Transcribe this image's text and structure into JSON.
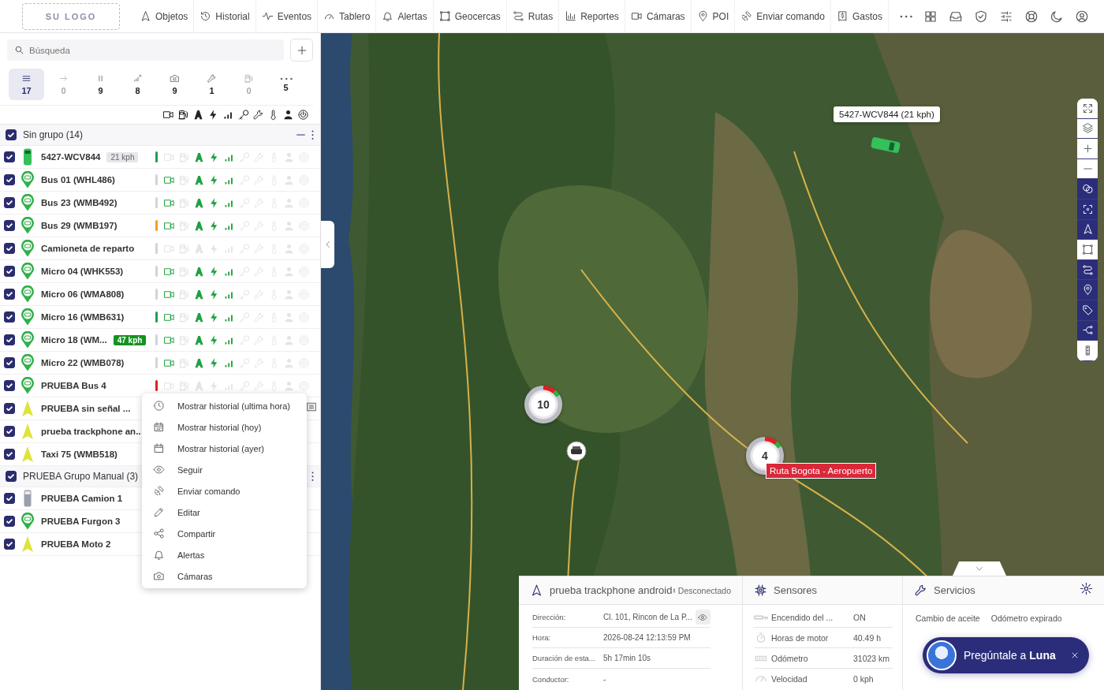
{
  "top_nav": {
    "logo": "SU LOGO",
    "items": [
      {
        "label": "Objetos"
      },
      {
        "label": "Historial"
      },
      {
        "label": "Eventos"
      },
      {
        "label": "Tablero"
      },
      {
        "label": "Alertas"
      },
      {
        "label": "Geocercas"
      },
      {
        "label": "Rutas"
      },
      {
        "label": "Reportes"
      },
      {
        "label": "Cámaras"
      },
      {
        "label": "POI"
      },
      {
        "label": "Enviar comando"
      },
      {
        "label": "Gastos"
      }
    ]
  },
  "left_panel": {
    "search": {
      "placeholder": "Búsqueda"
    },
    "filter_tabs": [
      {
        "count": "17",
        "selected": true,
        "disabled": false
      },
      {
        "count": "0",
        "selected": false,
        "disabled": true
      },
      {
        "count": "9",
        "selected": false,
        "disabled": false
      },
      {
        "count": "8",
        "selected": false,
        "disabled": false
      },
      {
        "count": "9",
        "selected": false,
        "disabled": false
      },
      {
        "count": "1",
        "selected": false,
        "disabled": false
      },
      {
        "count": "0",
        "selected": false,
        "disabled": true
      },
      {
        "count": "5",
        "selected": false,
        "disabled": false
      }
    ],
    "groups": [
      {
        "name": "Sin grupo (14)",
        "checked": true,
        "items": [
          {
            "name": "5427-WCV844",
            "checked": true,
            "kind": "car",
            "speed": {
              "text": "21 kph",
              "moving": false
            },
            "color": "#22a04b",
            "camera_on": false,
            "gps_on": true,
            "power_on": true,
            "gsm_on": true
          },
          {
            "name": "Bus 01 (WHL486)",
            "checked": true,
            "kind": "bus",
            "color": "#d2d2da",
            "camera_on": true,
            "gps_on": true,
            "power_on": true,
            "gsm_on": true
          },
          {
            "name": "Bus 23 (WMB492)",
            "checked": true,
            "kind": "bus",
            "color": "#d2d2da",
            "camera_on": true,
            "gps_on": true,
            "power_on": true,
            "gsm_on": true
          },
          {
            "name": "Bus 29 (WMB197)",
            "checked": true,
            "kind": "bus",
            "color": "#f0a020",
            "camera_on": true,
            "gps_on": true,
            "power_on": true,
            "gsm_on": true
          },
          {
            "name": "Camioneta de reparto",
            "checked": true,
            "kind": "pickup",
            "color": "#d2d2da",
            "camera_on": false,
            "gps_on": false,
            "power_on": false,
            "gsm_on": false
          },
          {
            "name": "Micro 04 (WHK553)",
            "checked": true,
            "kind": "van",
            "color": "#d2d2da",
            "camera_on": true,
            "gps_on": true,
            "power_on": true,
            "gsm_on": true
          },
          {
            "name": "Micro 06 (WMA808)",
            "checked": true,
            "kind": "van",
            "color": "#d2d2da",
            "camera_on": true,
            "gps_on": true,
            "power_on": true,
            "gsm_on": true
          },
          {
            "name": "Micro 16 (WMB631)",
            "checked": true,
            "kind": "van",
            "color": "#22a04b",
            "camera_on": true,
            "gps_on": true,
            "power_on": true,
            "gsm_on": true
          },
          {
            "name": "Micro 18 (WM...",
            "checked": true,
            "kind": "van",
            "speed": {
              "text": "47 kph",
              "moving": true
            },
            "color": "#d2d2da",
            "camera_on": true,
            "gps_on": true,
            "power_on": true,
            "gsm_on": true
          },
          {
            "name": "Micro 22 (WMB078)",
            "checked": true,
            "kind": "van",
            "color": "#d2d2da",
            "camera_on": true,
            "gps_on": true,
            "power_on": true,
            "gsm_on": true
          },
          {
            "name": "PRUEBA Bus 4",
            "checked": true,
            "kind": "bus",
            "color": "#e02020",
            "camera_on": false,
            "gps_on": false,
            "power_on": false,
            "gsm_on": false
          },
          {
            "name": "PRUEBA sin señal ...",
            "checked": true,
            "kind": "arrow",
            "menu_open": true
          },
          {
            "name": "prueba trackphone an..",
            "checked": true,
            "kind": "arrow"
          },
          {
            "name": "Taxi 75 (WMB518)",
            "checked": true,
            "kind": "arrow"
          }
        ]
      },
      {
        "name": "PRUEBA Grupo Manual (3)",
        "checked": true,
        "items": [
          {
            "name": "PRUEBA Camion 1",
            "checked": true,
            "kind": "truck"
          },
          {
            "name": "PRUEBA Furgon 3",
            "checked": true,
            "kind": "van"
          },
          {
            "name": "PRUEBA Moto 2",
            "checked": true,
            "kind": "arrow"
          }
        ]
      }
    ]
  },
  "context_menu": {
    "items": [
      {
        "label": "Mostrar historial (ultima hora)"
      },
      {
        "label": "Mostrar historial (hoy)"
      },
      {
        "label": "Mostrar historial (ayer)"
      },
      {
        "label": "Seguir"
      },
      {
        "label": "Enviar comando"
      },
      {
        "label": "Editar"
      },
      {
        "label": "Compartir"
      },
      {
        "label": "Alertas"
      },
      {
        "label": "Cámaras"
      }
    ]
  },
  "map": {
    "tooltip": "5427-WCV844 (21 kph)",
    "clusters": [
      {
        "count": "10"
      },
      {
        "count": "4"
      }
    ],
    "route_label": "Ruta Bogota - Aeropuerto",
    "tools": [
      {
        "on": false
      },
      {
        "on": false
      },
      {
        "on": false
      },
      {
        "on": false
      },
      {
        "on": true
      },
      {
        "on": true
      },
      {
        "on": true
      },
      {
        "on": false
      },
      {
        "on": true
      },
      {
        "on": true
      },
      {
        "on": true
      },
      {
        "on": true
      },
      {
        "on": false
      }
    ]
  },
  "object_panel": {
    "title": "prueba trackphone android",
    "connected": false,
    "status": "Desconectado",
    "rows": [
      {
        "label": "Dirección:",
        "value": "Cl. 101, Rincon de La P...",
        "revealable": true
      },
      {
        "label": "Hora:",
        "value": "2026-08-24 12:13:59 PM"
      },
      {
        "label": "Duración de esta...",
        "value": "5h 17min 10s"
      },
      {
        "label": "Conductor:",
        "value": "-"
      }
    ]
  },
  "sensors_panel": {
    "title": "Sensores",
    "rows": [
      {
        "label": "Encendido del ...",
        "value": "ON"
      },
      {
        "label": "Horas de motor",
        "value": "40.49 h"
      },
      {
        "label": "Odómetro",
        "value": "31023 km"
      },
      {
        "label": "Velocidad",
        "value": "0 kph"
      }
    ]
  },
  "services_panel": {
    "title": "Servicios",
    "items": [
      "Cambio de aceite",
      "Odómetro expirado"
    ]
  },
  "assistant": {
    "text": "Pregúntale a **Luna**"
  }
}
